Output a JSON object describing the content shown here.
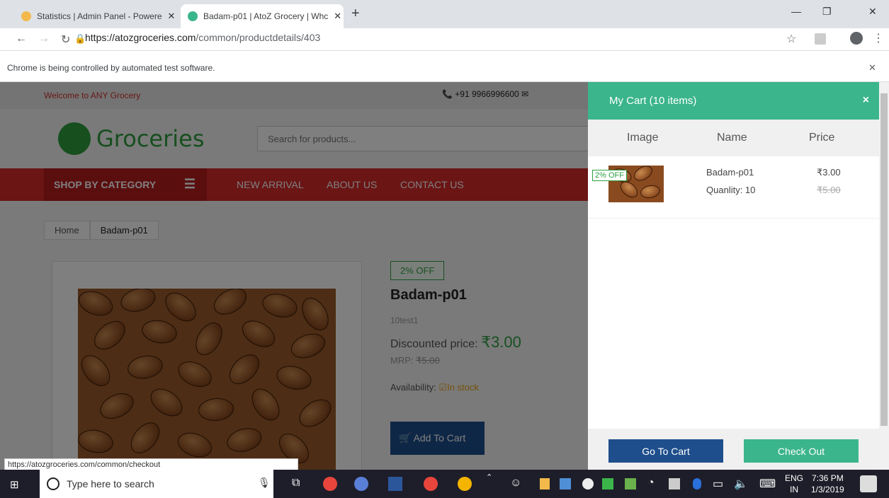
{
  "tabs": [
    {
      "label": "Statistics | Admin Panel - Powere",
      "active": false
    },
    {
      "label": "Badam-p01 | AtoZ Grocery | Whc",
      "active": true
    }
  ],
  "new_tab": "+",
  "window_controls": {
    "min": "—",
    "restore": "❐",
    "close": "✕"
  },
  "address": {
    "host": "https://atozgroceries.com",
    "path": "/common/productdetails/403"
  },
  "infobar": {
    "text": "Chrome is being controlled by automated test software.",
    "close": "✕"
  },
  "site": {
    "welcome": "Welcome to ANY Grocery",
    "phone": "+91 9966996600",
    "logo": "Groceries",
    "search_placeholder": "Search for products...",
    "nav": {
      "shop_by_category": "SHOP BY CATEGORY",
      "links": [
        "NEW ARRIVAL",
        "ABOUT US",
        "CONTACT US"
      ]
    },
    "breadcrumb": [
      "Home",
      "Badam-p01"
    ],
    "product": {
      "offer": "2% OFF",
      "name": "Badam-p01",
      "desc": "10test1",
      "discounted_label": "Discounted price:",
      "discounted_value": "₹3.00",
      "mrp_label": "MRP:",
      "mrp_value": "₹5.00",
      "availability_label": "Availability:",
      "availability_value": "In stock",
      "add_to_cart": "Add To Cart"
    }
  },
  "cart": {
    "title": "My Cart (10 items)",
    "close": "×",
    "columns": [
      "Image",
      "Name",
      "Price"
    ],
    "item": {
      "badge": "2% OFF",
      "name": "Badam-p01",
      "qty": "Quanlity: 10",
      "price": "₹3.00",
      "mrp": "₹5.00"
    },
    "go_to_cart": "Go To Cart",
    "check_out": "Check Out"
  },
  "status_url": "https://atozgroceries.com/common/checkout",
  "taskbar": {
    "search": "Type here to search",
    "lang1": "ENG",
    "lang2": "IN",
    "time": "7:36 PM",
    "date": "1/3/2019"
  }
}
